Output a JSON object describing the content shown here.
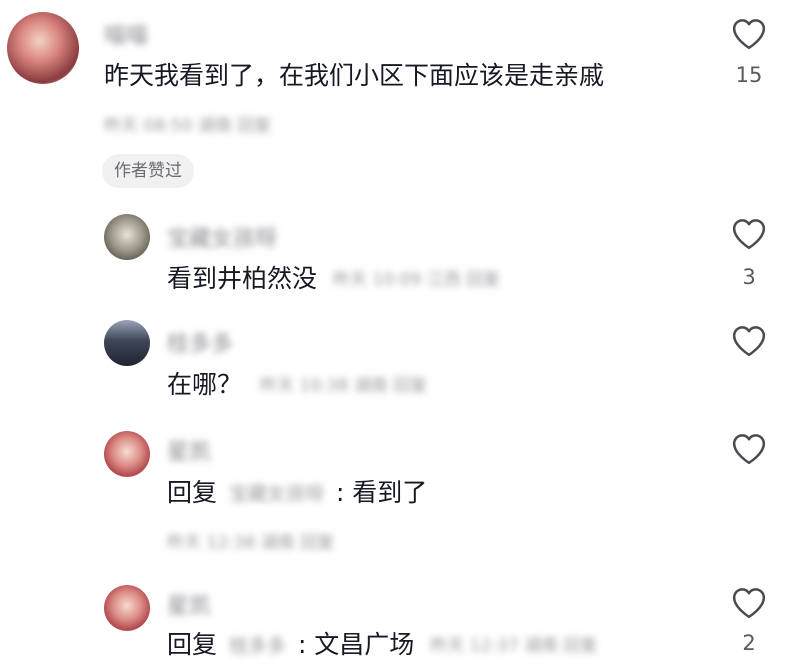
{
  "comments": [
    {
      "author": "喵喵",
      "text": "昨天我看到了，在我们小区下面应该是走亲戚",
      "meta": "昨天 08:50 湖南 回复",
      "likes": "15",
      "badge": "作者赞过",
      "replies": [
        {
          "author": "宝藏女孩呀",
          "prefix": "",
          "reply_to": "",
          "text": "看到井柏然没",
          "meta": "昨天 10:09 江西 回复",
          "likes": "3"
        },
        {
          "author": "桂多多",
          "prefix": "",
          "reply_to": "",
          "text": "在哪？",
          "meta": "昨天 10:38 湖南 回复",
          "likes": ""
        },
        {
          "author": "星凯",
          "prefix": "回复",
          "reply_to": "宝藏女孩呀",
          "text": ": 看到了",
          "meta": "昨天 12:38 湖南 回复",
          "likes": ""
        },
        {
          "author": "星凯",
          "prefix": "回复",
          "reply_to": "桂多多",
          "text": ": 文昌广场",
          "meta": "昨天 12:37 湖南 回复",
          "likes": "2"
        }
      ]
    }
  ],
  "icons": {
    "like": "heart-outline-icon"
  },
  "colors": {
    "text": "#161823",
    "secondary": "#9a9ba0",
    "badge_bg": "#f1f1f2"
  }
}
